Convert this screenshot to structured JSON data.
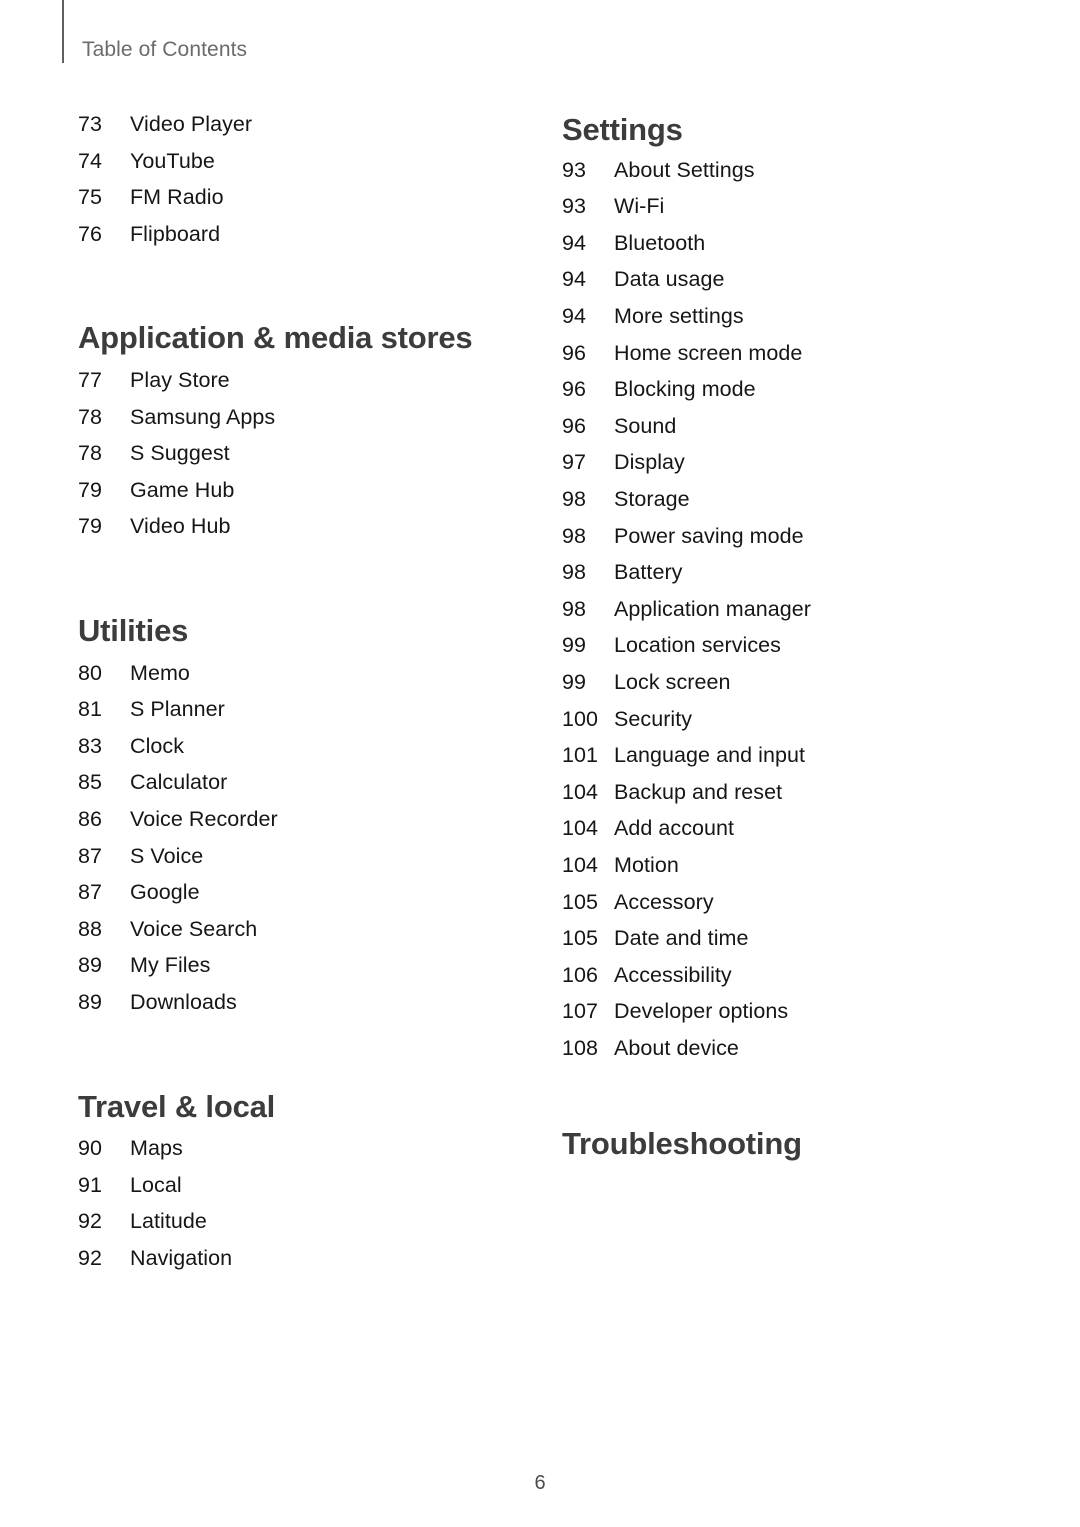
{
  "header": {
    "running_head": "Table of Contents"
  },
  "footer": {
    "page_number": "6"
  },
  "colors": {
    "heading": "#3c3c3c",
    "body": "#161616",
    "running_head": "#6b6b6b",
    "rule": "#5f5f5f",
    "page_background": "#ffffff"
  },
  "columns": {
    "left": {
      "sections": [
        {
          "heading": null,
          "entries": [
            {
              "page": "73",
              "label": "Video Player"
            },
            {
              "page": "74",
              "label": "YouTube"
            },
            {
              "page": "75",
              "label": "FM Radio"
            },
            {
              "page": "76",
              "label": "Flipboard"
            }
          ]
        },
        {
          "heading": "Application & media stores",
          "entries": [
            {
              "page": "77",
              "label": "Play Store"
            },
            {
              "page": "78",
              "label": "Samsung Apps"
            },
            {
              "page": "78",
              "label": "S Suggest"
            },
            {
              "page": "79",
              "label": "Game Hub"
            },
            {
              "page": "79",
              "label": "Video Hub"
            }
          ]
        },
        {
          "heading": "Utilities",
          "entries": [
            {
              "page": "80",
              "label": "Memo"
            },
            {
              "page": "81",
              "label": "S Planner"
            },
            {
              "page": "83",
              "label": "Clock"
            },
            {
              "page": "85",
              "label": "Calculator"
            },
            {
              "page": "86",
              "label": "Voice Recorder"
            },
            {
              "page": "87",
              "label": "S Voice"
            },
            {
              "page": "87",
              "label": "Google"
            },
            {
              "page": "88",
              "label": "Voice Search"
            },
            {
              "page": "89",
              "label": "My Files"
            },
            {
              "page": "89",
              "label": "Downloads"
            }
          ]
        },
        {
          "heading": "Travel & local",
          "entries": [
            {
              "page": "90",
              "label": "Maps"
            },
            {
              "page": "91",
              "label": "Local"
            },
            {
              "page": "92",
              "label": "Latitude"
            },
            {
              "page": "92",
              "label": "Navigation"
            }
          ]
        }
      ]
    },
    "right": {
      "sections": [
        {
          "heading": "Settings",
          "entries": [
            {
              "page": "93",
              "label": "About Settings"
            },
            {
              "page": "93",
              "label": "Wi-Fi"
            },
            {
              "page": "94",
              "label": "Bluetooth"
            },
            {
              "page": "94",
              "label": "Data usage"
            },
            {
              "page": "94",
              "label": "More settings"
            },
            {
              "page": "96",
              "label": "Home screen mode"
            },
            {
              "page": "96",
              "label": "Blocking mode"
            },
            {
              "page": "96",
              "label": "Sound"
            },
            {
              "page": "97",
              "label": "Display"
            },
            {
              "page": "98",
              "label": "Storage"
            },
            {
              "page": "98",
              "label": "Power saving mode"
            },
            {
              "page": "98",
              "label": "Battery"
            },
            {
              "page": "98",
              "label": "Application manager"
            },
            {
              "page": "99",
              "label": "Location services"
            },
            {
              "page": "99",
              "label": "Lock screen"
            },
            {
              "page": "100",
              "label": "Security"
            },
            {
              "page": "101",
              "label": "Language and input"
            },
            {
              "page": "104",
              "label": "Backup and reset"
            },
            {
              "page": "104",
              "label": "Add account"
            },
            {
              "page": "104",
              "label": "Motion"
            },
            {
              "page": "105",
              "label": "Accessory"
            },
            {
              "page": "105",
              "label": "Date and time"
            },
            {
              "page": "106",
              "label": "Accessibility"
            },
            {
              "page": "107",
              "label": "Developer options"
            },
            {
              "page": "108",
              "label": "About device"
            }
          ]
        },
        {
          "heading": "Troubleshooting",
          "entries": []
        }
      ]
    }
  }
}
